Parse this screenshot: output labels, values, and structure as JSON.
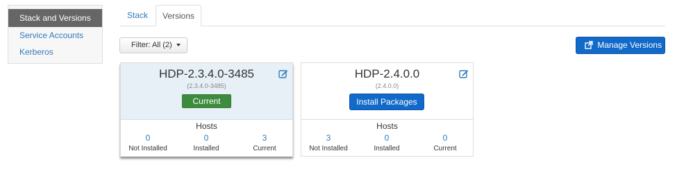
{
  "sidebar": {
    "items": [
      {
        "label": "Stack and Versions"
      },
      {
        "label": "Service Accounts"
      },
      {
        "label": "Kerberos"
      }
    ]
  },
  "tabs": [
    {
      "label": "Stack"
    },
    {
      "label": "Versions"
    }
  ],
  "toolbar": {
    "filter_label": "Filter: All (2)",
    "manage_label": "Manage Versions"
  },
  "versions": [
    {
      "name": "HDP-2.3.4.0-3485",
      "subtitle": "(2.3.4.0-3485)",
      "action_label": "Current",
      "hosts_title": "Hosts",
      "hosts": [
        {
          "count": "0",
          "label": "Not Installed"
        },
        {
          "count": "0",
          "label": "Installed"
        },
        {
          "count": "3",
          "label": "Current"
        }
      ]
    },
    {
      "name": "HDP-2.4.0.0",
      "subtitle": "(2.4.0.0)",
      "action_label": "Install Packages",
      "hosts_title": "Hosts",
      "hosts": [
        {
          "count": "3",
          "label": "Not Installed"
        },
        {
          "count": "0",
          "label": "Installed"
        },
        {
          "count": "0",
          "label": "Current"
        }
      ]
    }
  ],
  "colors": {
    "primary": "#1169c9",
    "success": "#3d8b3d",
    "link": "#337ab7",
    "active_nav": "#666666",
    "current_card": "#e6f0f6"
  }
}
